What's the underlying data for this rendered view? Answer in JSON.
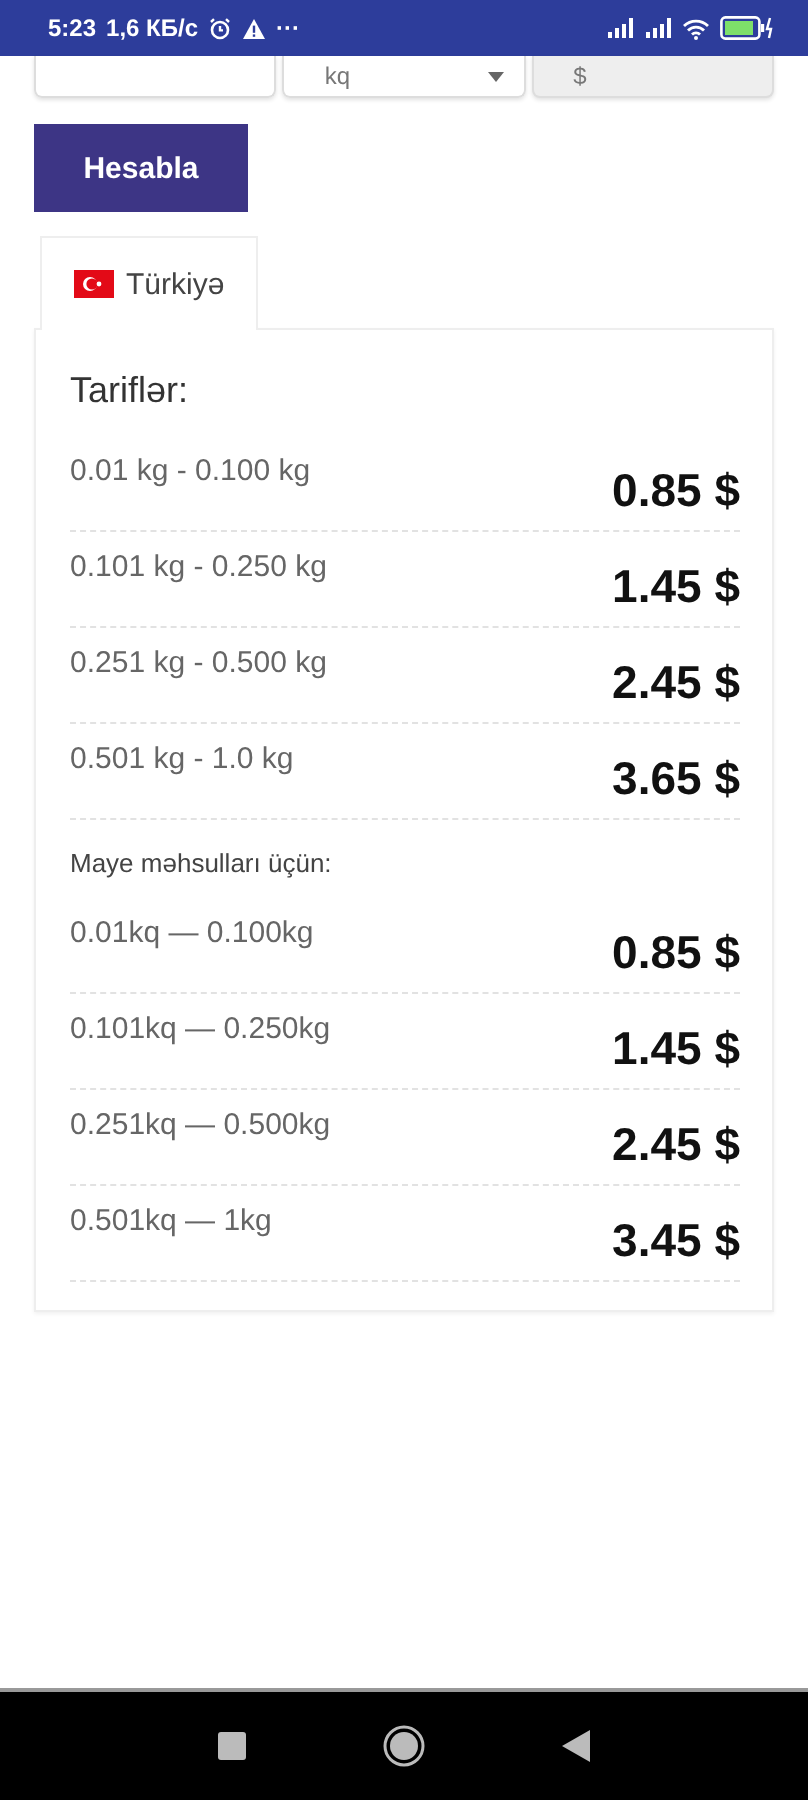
{
  "status_bar": {
    "time": "5:23",
    "speed": "1,6 КБ/с",
    "more": "···"
  },
  "inputs": [
    {
      "kind": "text"
    },
    {
      "kind": "select",
      "value": "kq"
    },
    {
      "kind": "readonly",
      "value": "$"
    }
  ],
  "calculate_button": "Hesabla",
  "tabs": [
    {
      "label": "Türkiyə",
      "selected": true
    }
  ],
  "tariffs": {
    "title": "Tariflər:",
    "rows": [
      {
        "range": "0.01 kg - 0.100 kg",
        "price": "0.85 $"
      },
      {
        "range": "0.101 kg - 0.250 kg",
        "price": "1.45 $"
      },
      {
        "range": "0.251 kg - 0.500 kg",
        "price": "2.45 $"
      },
      {
        "range": "0.501 kg - 1.0 kg",
        "price": "3.65 $"
      }
    ],
    "liquid_title": "Maye məhsulları üçün:",
    "liquid_rows": [
      {
        "range": "0.01kq — 0.100kg",
        "price": "0.85 $"
      },
      {
        "range": "0.101kq — 0.250kg",
        "price": "1.45 $"
      },
      {
        "range": "0.251kq — 0.500kg",
        "price": "2.45 $"
      },
      {
        "range": "0.501kq — 1kg",
        "price": "3.45 $"
      }
    ]
  }
}
